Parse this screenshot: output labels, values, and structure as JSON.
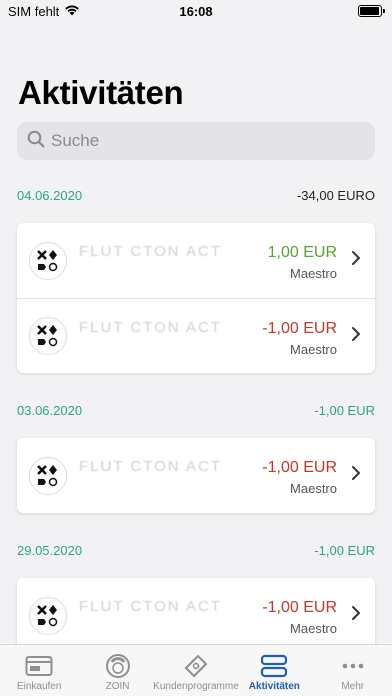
{
  "status": {
    "carrier": "SIM fehlt",
    "time": "16:08",
    "battery_level": 0.95
  },
  "page": {
    "title": "Aktivitäten"
  },
  "search": {
    "placeholder": "Suche",
    "value": ""
  },
  "groups": [
    {
      "date": "04.06.2020",
      "total": "-34,00 EURO",
      "transactions": [
        {
          "merchant": "FLUT CTON ACT",
          "amount": "1,00 EUR",
          "sign": "positive",
          "card": "Maestro"
        },
        {
          "merchant": "FLUT CTON ACT",
          "amount": "-1,00 EUR",
          "sign": "negative",
          "card": "Maestro"
        }
      ]
    },
    {
      "date": "03.06.2020",
      "total": "-1,00 EUR",
      "transactions": [
        {
          "merchant": "FLUT CTON ACT",
          "amount": "-1,00 EUR",
          "sign": "negative",
          "card": "Maestro"
        }
      ]
    },
    {
      "date": "29.05.2020",
      "total": "-1,00 EUR",
      "transactions": [
        {
          "merchant": "FLUT CTON ACT",
          "amount": "-1,00 EUR",
          "sign": "negative",
          "card": "Maestro"
        }
      ]
    }
  ],
  "tabs": [
    {
      "label": "Einkaufen",
      "icon": "card-icon",
      "active": false
    },
    {
      "label": "ZOIN",
      "icon": "zoin-icon",
      "active": false
    },
    {
      "label": "Kundenprogramme",
      "icon": "ticket-icon",
      "active": false
    },
    {
      "label": "Aktivitäten",
      "icon": "activity-icon",
      "active": true
    },
    {
      "label": "Mehr",
      "icon": "more-icon",
      "active": false
    }
  ],
  "colors": {
    "accent": "#2aa58a",
    "positive": "#58a22f",
    "negative": "#c0392b",
    "tab_active": "#1f5fae"
  }
}
